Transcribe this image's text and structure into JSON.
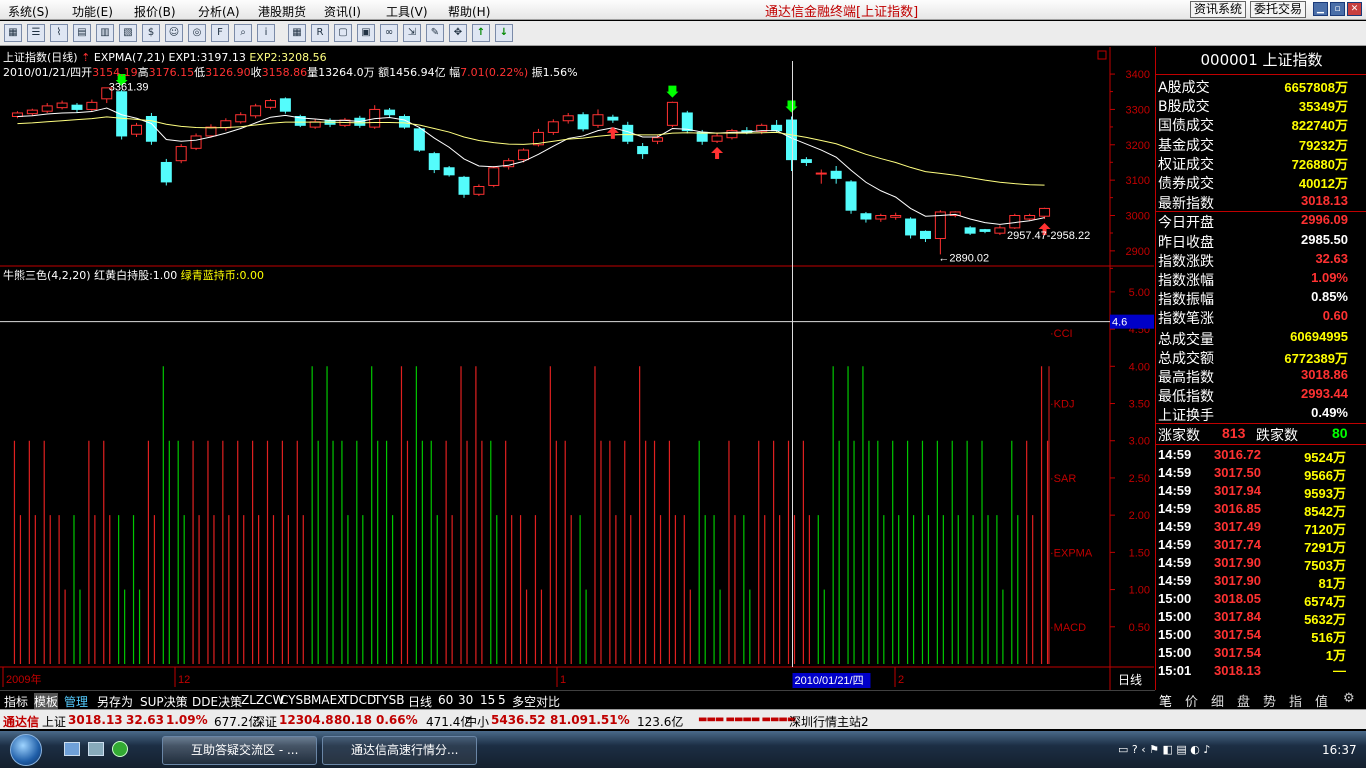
{
  "menu": {
    "items": [
      "系统(S)",
      "功能(E)",
      "报价(B)",
      "分析(A)",
      "港股期货",
      "资讯(I)",
      "工具(V)",
      "帮助(H)"
    ],
    "title": "通达信金融终端[上证指数]",
    "btn_news": "资讯系统",
    "btn_trade": "委托交易"
  },
  "colors": {
    "up": "#ff3232",
    "down": "#54fcfc",
    "ma1": "#ffffff",
    "ma2": "#ffff80",
    "green": "#00c800",
    "accent": "#c00000"
  },
  "toolbar_icons": [
    "chart-icon",
    "list-icon",
    "line-icon",
    "grid-icon",
    "table-icon",
    "doc-icon",
    "money-icon",
    "people-icon",
    "radar-icon",
    "f10-icon",
    "zoom-icon",
    "info-icon",
    "grid2-icon",
    "rsi-icon",
    "window-icon",
    "calc-icon",
    "link-icon",
    "export-icon",
    "pen-icon",
    "move-icon",
    "arrow-up-icon",
    "arrow-down-icon"
  ],
  "main": {
    "title": "上证指数(日线)",
    "expma_name": "EXPMA(7,21)",
    "exp1": "EXP1:3197.13",
    "exp2": "EXP2:3208.56",
    "date": "2010/01/21/四",
    "open_l": "开",
    "open": "3154.19",
    "high_l": "高",
    "high": "3176.15",
    "low_l": "低",
    "low": "3126.90",
    "close_l": "收",
    "close": "3158.86",
    "vol_l": "量",
    "vol": "13264.0万",
    "amt_l": "额",
    "amt": "1456.94亿",
    "chg_l": "幅",
    "chg": "7.01(0.22%)",
    "amp": "振1.56%",
    "hi_label": "3361.39",
    "lo_label": "←2890.02",
    "last_label": "2957.47-2958.22"
  },
  "sub": {
    "title": "牛熊三色(4,2,20)",
    "red_label": "红黄白持股:1.00",
    "green_label": "绿青蓝持币:0.00",
    "cursor_value": "4.6",
    "indicators": [
      "CCI",
      "KDJ",
      "SAR",
      "EXPMA",
      "MACD"
    ]
  },
  "axis": {
    "main_ticks": [
      "3400",
      "3300",
      "3200",
      "3100",
      "3000",
      "2900"
    ],
    "sub_ticks": [
      "5.00",
      "4.50",
      "4.00",
      "3.50",
      "3.00",
      "2.50",
      "2.00",
      "1.50",
      "1.00",
      "0.50"
    ],
    "x_labels": [
      "2009年",
      "12",
      "1",
      "2"
    ],
    "cursor_date": "2010/01/21/四",
    "period": "日线"
  },
  "chart_data": {
    "type": "candlestick",
    "title": "上证指数(日线)",
    "ylim": [
      2860,
      3420
    ],
    "candles": [
      [
        3280,
        3290,
        3275,
        3295
      ],
      [
        3288,
        3298,
        3282,
        3302
      ],
      [
        3295,
        3310,
        3290,
        3318
      ],
      [
        3305,
        3318,
        3300,
        3325
      ],
      [
        3312,
        3300,
        3290,
        3318
      ],
      [
        3300,
        3320,
        3295,
        3328
      ],
      [
        3330,
        3361,
        3318,
        3361
      ],
      [
        3350,
        3225,
        3215,
        3355
      ],
      [
        3230,
        3255,
        3222,
        3262
      ],
      [
        3280,
        3210,
        3200,
        3290
      ],
      [
        3150,
        3095,
        3085,
        3160
      ],
      [
        3155,
        3195,
        3148,
        3202
      ],
      [
        3190,
        3225,
        3185,
        3232
      ],
      [
        3225,
        3250,
        3220,
        3258
      ],
      [
        3248,
        3268,
        3240,
        3275
      ],
      [
        3265,
        3285,
        3260,
        3292
      ],
      [
        3282,
        3310,
        3275,
        3316
      ],
      [
        3306,
        3325,
        3300,
        3330
      ],
      [
        3330,
        3295,
        3288,
        3334
      ],
      [
        3280,
        3255,
        3250,
        3285
      ],
      [
        3250,
        3265,
        3245,
        3272
      ],
      [
        3268,
        3258,
        3250,
        3275
      ],
      [
        3255,
        3270,
        3250,
        3276
      ],
      [
        3275,
        3255,
        3248,
        3282
      ],
      [
        3250,
        3300,
        3245,
        3312
      ],
      [
        3298,
        3285,
        3278,
        3304
      ],
      [
        3280,
        3250,
        3245,
        3286
      ],
      [
        3245,
        3185,
        3180,
        3250
      ],
      [
        3175,
        3130,
        3120,
        3180
      ],
      [
        3135,
        3115,
        3110,
        3140
      ],
      [
        3108,
        3060,
        3050,
        3112
      ],
      [
        3060,
        3082,
        3055,
        3088
      ],
      [
        3085,
        3135,
        3080,
        3140
      ],
      [
        3138,
        3155,
        3130,
        3162
      ],
      [
        3158,
        3185,
        3150,
        3190
      ],
      [
        3200,
        3235,
        3195,
        3245
      ],
      [
        3235,
        3265,
        3228,
        3272
      ],
      [
        3268,
        3282,
        3260,
        3290
      ],
      [
        3285,
        3245,
        3238,
        3292
      ],
      [
        3255,
        3285,
        3248,
        3300
      ],
      [
        3278,
        3270,
        3262,
        3285
      ],
      [
        3255,
        3210,
        3202,
        3265
      ],
      [
        3195,
        3175,
        3160,
        3205
      ],
      [
        3210,
        3220,
        3202,
        3228
      ],
      [
        3255,
        3320,
        3250,
        3322
      ],
      [
        3290,
        3240,
        3232,
        3296
      ],
      [
        3235,
        3210,
        3200,
        3242
      ],
      [
        3210,
        3225,
        3205,
        3232
      ],
      [
        3220,
        3240,
        3215,
        3245
      ],
      [
        3240,
        3235,
        3230,
        3250
      ],
      [
        3238,
        3255,
        3230,
        3260
      ],
      [
        3255,
        3240,
        3235,
        3270
      ],
      [
        3270,
        3158,
        3126,
        3280
      ],
      [
        3158,
        3150,
        3140,
        3165
      ],
      [
        3120,
        3120,
        3090,
        3130
      ],
      [
        3125,
        3105,
        3090,
        3140
      ],
      [
        3095,
        3015,
        3005,
        3100
      ],
      [
        3005,
        2990,
        2980,
        3010
      ],
      [
        2990,
        3000,
        2982,
        3005
      ],
      [
        2995,
        3000,
        2988,
        3008
      ],
      [
        2990,
        2945,
        2935,
        2995
      ],
      [
        2955,
        2935,
        2925,
        2958
      ],
      [
        2935,
        3010,
        2890,
        3015
      ],
      [
        3000,
        3010,
        2995,
        3012
      ],
      [
        2965,
        2950,
        2945,
        2970
      ],
      [
        2960,
        2955,
        2950,
        2962
      ],
      [
        2950,
        2965,
        2945,
        2972
      ],
      [
        2965,
        3000,
        2962,
        3005
      ],
      [
        2990,
        3000,
        2985,
        3005
      ],
      [
        2998,
        3020,
        2990,
        3022
      ]
    ],
    "exp1": [
      3280,
      3282,
      3287,
      3290,
      3291,
      3294,
      3304,
      3285,
      3275,
      3260,
      3215,
      3210,
      3213,
      3222,
      3233,
      3246,
      3262,
      3278,
      3283,
      3276,
      3273,
      3269,
      3269,
      3266,
      3274,
      3277,
      3270,
      3249,
      3219,
      3193,
      3160,
      3140,
      3138,
      3142,
      3153,
      3173,
      3196,
      3218,
      3225,
      3240,
      3248,
      3237,
      3222,
      3222,
      3246,
      3244,
      3236,
      3233,
      3235,
      3236,
      3240,
      3240,
      3219,
      3202,
      3185,
      3165,
      3128,
      3094,
      3070,
      3052,
      3020,
      2998,
      3000,
      3003,
      2990,
      2980,
      2975,
      2980,
      2985,
      2994
    ],
    "exp2": [
      3260,
      3262,
      3265,
      3268,
      3271,
      3274,
      3279,
      3275,
      3272,
      3268,
      3258,
      3252,
      3249,
      3248,
      3249,
      3251,
      3256,
      3261,
      3264,
      3264,
      3264,
      3264,
      3263,
      3262,
      3263,
      3263,
      3262,
      3256,
      3246,
      3236,
      3222,
      3212,
      3206,
      3202,
      3201,
      3204,
      3210,
      3216,
      3219,
      3224,
      3228,
      3229,
      3228,
      3228,
      3233,
      3234,
      3233,
      3233,
      3233,
      3233,
      3234,
      3235,
      3228,
      3221,
      3212,
      3203,
      3188,
      3173,
      3161,
      3150,
      3136,
      3124,
      3119,
      3114,
      3107,
      3100,
      3094,
      3090,
      3087,
      3086
    ],
    "bull_bear": [
      3,
      3,
      3,
      2,
      2,
      3,
      3,
      2,
      2,
      3,
      4,
      3,
      3,
      3,
      3,
      3,
      3,
      3,
      3,
      3,
      4,
      4,
      3,
      3,
      4,
      3,
      4,
      4,
      3,
      3,
      4,
      4,
      3,
      3,
      2,
      2,
      4,
      3,
      2,
      4,
      3,
      3,
      4,
      3,
      3,
      2,
      3,
      2,
      3,
      2,
      3,
      3,
      3,
      3,
      2,
      4,
      4,
      4,
      3,
      3,
      3,
      3,
      3,
      3,
      3,
      3,
      2,
      3,
      3,
      4
    ],
    "bull_bear_side": [
      1,
      1,
      1,
      1,
      0,
      1,
      1,
      0,
      0,
      1,
      0,
      0,
      1,
      1,
      1,
      1,
      1,
      1,
      1,
      1,
      0,
      0,
      0,
      0,
      0,
      0,
      1,
      0,
      0,
      1,
      1,
      1,
      0,
      1,
      1,
      1,
      1,
      1,
      0,
      1,
      1,
      1,
      1,
      1,
      1,
      1,
      0,
      0,
      1,
      0,
      1,
      1,
      1,
      1,
      0,
      0,
      0,
      0,
      0,
      0,
      0,
      0,
      0,
      0,
      0,
      0,
      0,
      0,
      1,
      1
    ],
    "sub_ylim": [
      0,
      5.2
    ]
  },
  "right": {
    "code_name": "000001 上证指数",
    "rows": [
      [
        "A股成交",
        "6657808万",
        "y"
      ],
      [
        "B股成交",
        "35349万",
        "y"
      ],
      [
        "国债成交",
        "822740万",
        "y"
      ],
      [
        "基金成交",
        "79232万",
        "y"
      ],
      [
        "权证成交",
        "726880万",
        "y"
      ],
      [
        "债券成交",
        "40012万",
        "y"
      ],
      [
        "最新指数",
        "3018.13",
        "r"
      ],
      [
        "今日开盘",
        "2996.09",
        "r"
      ],
      [
        "昨日收盘",
        "2985.50",
        "w"
      ],
      [
        "指数涨跌",
        "32.63",
        "r"
      ],
      [
        "指数涨幅",
        "1.09%",
        "r"
      ],
      [
        "指数振幅",
        "0.85%",
        "w"
      ],
      [
        "指数笔涨",
        "0.60",
        "r"
      ],
      [
        "总成交量",
        "60694995",
        "y"
      ],
      [
        "总成交额",
        "6772389万",
        "y"
      ],
      [
        "最高指数",
        "3018.86",
        "r"
      ],
      [
        "最低指数",
        "2993.44",
        "r"
      ],
      [
        "上证换手",
        "0.49%",
        "w"
      ]
    ],
    "up_label": "涨家数",
    "up_count": "813",
    "down_label": "跌家数",
    "down_count": "80",
    "ticks": [
      [
        "14:59",
        "3016.72",
        "9524万"
      ],
      [
        "14:59",
        "3017.50",
        "9566万"
      ],
      [
        "14:59",
        "3017.94",
        "9593万"
      ],
      [
        "14:59",
        "3016.85",
        "8542万"
      ],
      [
        "14:59",
        "3017.49",
        "7120万"
      ],
      [
        "14:59",
        "3017.74",
        "7291万"
      ],
      [
        "14:59",
        "3017.90",
        "7503万"
      ],
      [
        "14:59",
        "3017.90",
        "81万"
      ],
      [
        "15:00",
        "3018.05",
        "6574万"
      ],
      [
        "15:00",
        "3017.84",
        "5632万"
      ],
      [
        "15:00",
        "3017.54",
        "516万"
      ],
      [
        "15:00",
        "3017.54",
        "1万"
      ],
      [
        "15:01",
        "3018.13",
        "—"
      ]
    ],
    "tabs": [
      "笔",
      "价",
      "细",
      "盘",
      "势",
      "指",
      "值"
    ]
  },
  "bottom_tabs": [
    "指标",
    "模板",
    "管理",
    "另存为",
    "SUP决策",
    "DDE决策",
    "ZLZCW",
    "CYSB",
    "MAEX",
    "TDCD",
    "TYSB",
    "日线",
    "60",
    "30",
    "15",
    "5",
    "多空对比"
  ],
  "status": {
    "brand": "通达信",
    "sh_name": "上证",
    "sh": "3018.13",
    "sh_chg": "32.63",
    "sh_pct": "1.09%",
    "sh_amt": "677.2亿",
    "sz_name": "深证",
    "sz": "12304.8",
    "sz_chg": "80.18",
    "sz_pct": "0.66%",
    "sz_amt": "471.4亿",
    "zx_name": "中小",
    "zx": "5436.52",
    "zx_chg": "81.09",
    "zx_pct": "1.51%",
    "zx_amt": "123.6亿",
    "server": "深圳行情主站2"
  },
  "taskbar": {
    "tasks": [
      "互助答疑交流区 - ...",
      "通达信高速行情分..."
    ],
    "clock": "16:37"
  }
}
